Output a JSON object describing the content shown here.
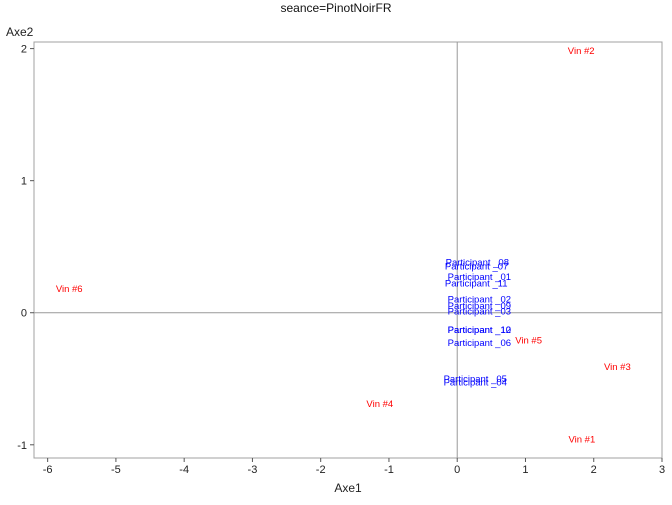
{
  "chart_data": {
    "type": "scatter",
    "title": "seance=PinotNoirFR",
    "xlabel": "Axe1",
    "ylabel": "Axe2",
    "xlim": [
      -6.2,
      3.0
    ],
    "ylim": [
      -1.1,
      2.05
    ],
    "xticks": [
      "-6",
      "-5",
      "-4",
      "-3",
      "-2",
      "-1",
      "0",
      "1",
      "2",
      "3"
    ],
    "yticks": [
      "-1",
      "0",
      "1",
      "2"
    ],
    "reference_lines": {
      "x": 0,
      "y": 0
    },
    "grid": false,
    "colors": {
      "vins": "#ff0000",
      "participants": "#0000ff",
      "frame": "#a0a0a0",
      "reflines": "#999999"
    },
    "series": [
      {
        "group": "vins",
        "points": [
          {
            "label": "Vin #2",
            "x": 1.62,
            "y": 1.98
          },
          {
            "label": "Vin #6",
            "x": -5.88,
            "y": 0.18
          },
          {
            "label": "Vin #5",
            "x": 0.85,
            "y": -0.21
          },
          {
            "label": "Vin #3",
            "x": 2.15,
            "y": -0.41
          },
          {
            "label": "Vin #4",
            "x": -1.33,
            "y": -0.69
          },
          {
            "label": "Vin #1",
            "x": 1.63,
            "y": -0.96
          }
        ]
      },
      {
        "group": "participants",
        "points": [
          {
            "label": "Participant _08",
            "x": -0.17,
            "y": 0.38
          },
          {
            "label": "Participant _07",
            "x": -0.18,
            "y": 0.35
          },
          {
            "label": "Participant _01",
            "x": -0.14,
            "y": 0.27
          },
          {
            "label": "Participant _11",
            "x": -0.18,
            "y": 0.22
          },
          {
            "label": "Participant _02",
            "x": -0.14,
            "y": 0.1
          },
          {
            "label": "Participant _09",
            "x": -0.14,
            "y": 0.05
          },
          {
            "label": "Participant _03",
            "x": -0.14,
            "y": 0.01
          },
          {
            "label": "Participant _10",
            "x": -0.14,
            "y": -0.13
          },
          {
            "label": "Participant _12",
            "x": -0.14,
            "y": -0.13
          },
          {
            "label": "Participant _06",
            "x": -0.14,
            "y": -0.23
          },
          {
            "label": "Participant _05",
            "x": -0.2,
            "y": -0.5
          },
          {
            "label": "Participant _04",
            "x": -0.2,
            "y": -0.53
          }
        ]
      }
    ]
  }
}
